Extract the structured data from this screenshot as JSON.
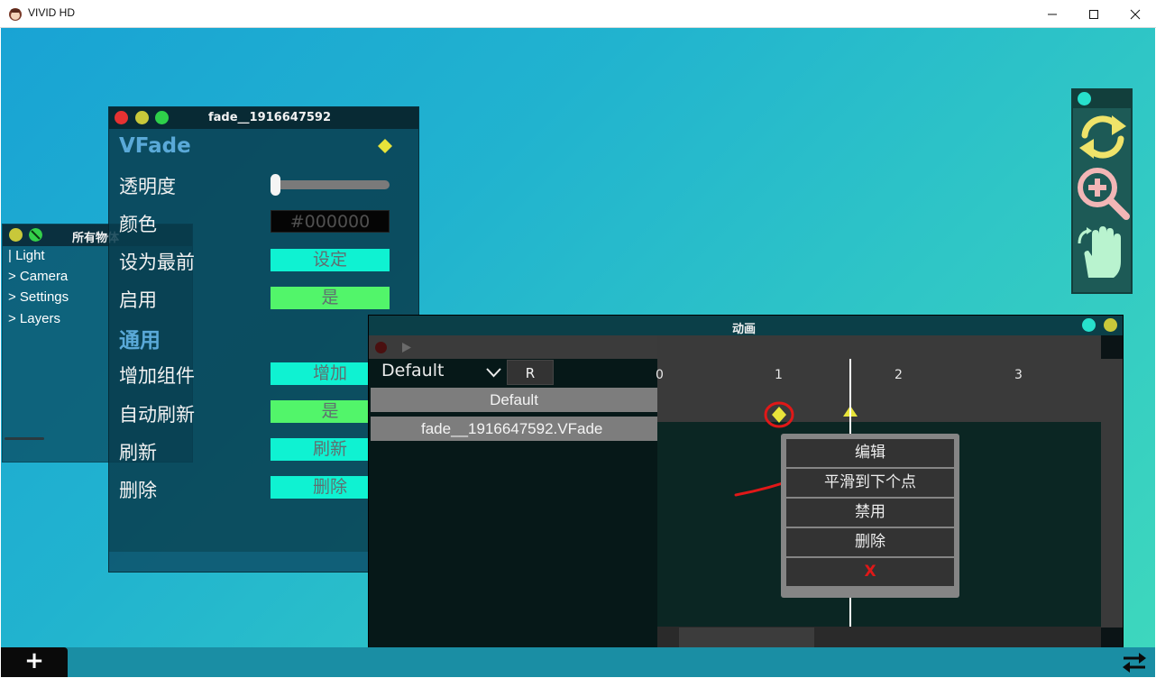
{
  "window": {
    "title": "VIVID HD",
    "minimize_icon": "minimize-icon",
    "maximize_icon": "maximize-icon",
    "close_icon": "close-icon"
  },
  "objects_panel": {
    "title": "所有物体",
    "items": [
      "| Light",
      "> Camera",
      "> Settings",
      "> Layers"
    ]
  },
  "inspector": {
    "title": "fade__1916647592",
    "component": "VFade",
    "rows": {
      "opacity": "透明度",
      "color": "颜色",
      "color_value": "#000000",
      "bring_front": "设为最前",
      "bring_front_btn": "设定",
      "enable": "启用",
      "enable_btn": "是",
      "general": "通用",
      "add_component": "增加组件",
      "add_component_btn": "增加",
      "auto_refresh": "自动刷新",
      "auto_refresh_btn": "是",
      "refresh": "刷新",
      "refresh_btn": "刷新",
      "delete": "删除",
      "delete_btn": "删除"
    },
    "opacity_value": 0
  },
  "animation": {
    "title": "动画",
    "clip": "Default",
    "r_button": "R",
    "rows": [
      "Default",
      "fade__1916647592.VFade"
    ],
    "ruler": [
      "0",
      "1",
      "2",
      "3"
    ]
  },
  "context_menu": {
    "items": [
      "编辑",
      "平滑到下个点",
      "禁用",
      "删除",
      "X"
    ]
  },
  "bottom": {
    "add_label": "+"
  },
  "colors": {
    "accent_cyan": "#0ff2d2",
    "accent_green": "#52f56a",
    "keyframe_yellow": "#e8e43a",
    "annotation_red": "#e01818"
  }
}
